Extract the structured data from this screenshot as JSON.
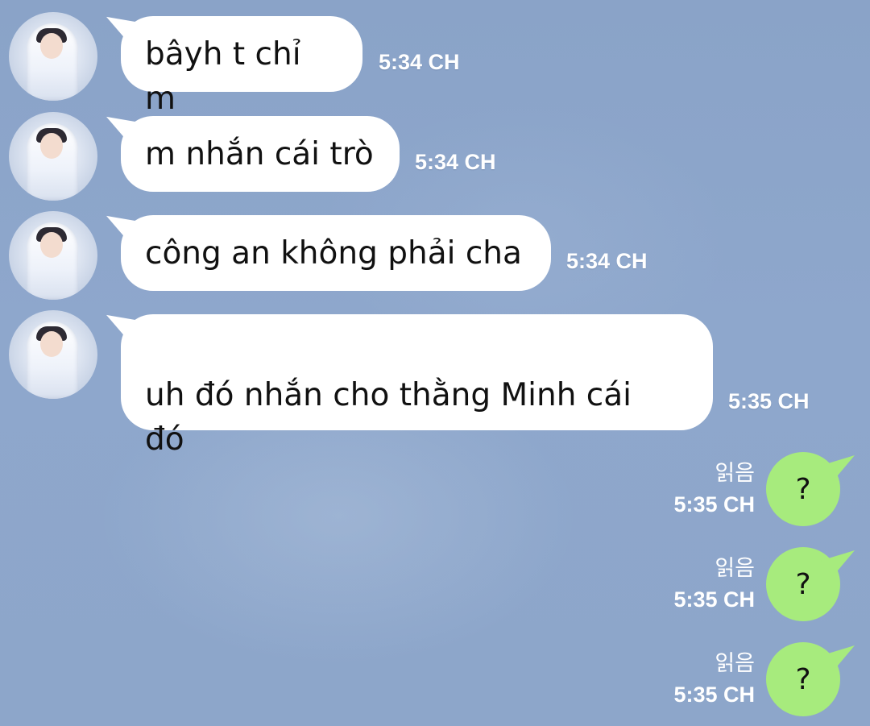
{
  "incoming": [
    {
      "text": "bâyh t chỉ m",
      "time": "5:34 CH"
    },
    {
      "text": "m nhắn cái trò",
      "time": "5:34 CH"
    },
    {
      "text": "công an không phải cha",
      "time": "5:34 CH"
    },
    {
      "text": "uh đó nhắn cho thằng Minh cái\nđó",
      "time": "5:35 CH"
    }
  ],
  "outgoing": [
    {
      "text": "?",
      "read_label": "읽음",
      "time": "5:35 CH"
    },
    {
      "text": "?",
      "read_label": "읽음",
      "time": "5:35 CH"
    },
    {
      "text": "?",
      "read_label": "읽음",
      "time": "5:35 CH"
    }
  ],
  "colors": {
    "incoming_bubble": "#ffffff",
    "outgoing_bubble": "#a7eb7d",
    "background": "#8da6ca"
  }
}
